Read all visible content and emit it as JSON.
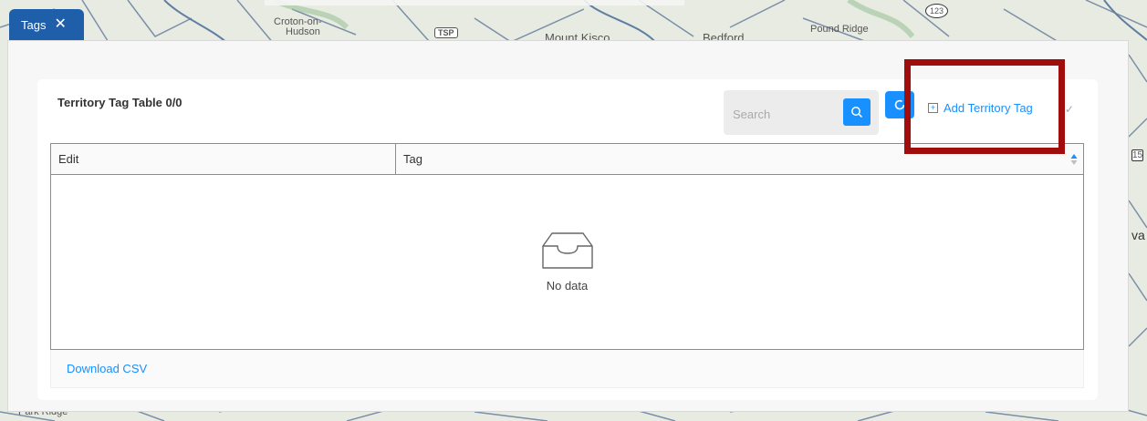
{
  "map": {
    "labels": {
      "croton": "Croton-on-",
      "hudson": "Hudson",
      "tsp": "TSP",
      "mount_kisco": "Mount Kisco",
      "bedford": "Bedford",
      "pound_ridge": "Pound Ridge",
      "route_123": "123",
      "park_ridge": "Park Ridge",
      "edge_15": "15",
      "edge_va": "va"
    }
  },
  "tab": {
    "label": "Tags",
    "close_glyph": "✕"
  },
  "card": {
    "title": "Territory Tag Table 0/0",
    "search_placeholder": "Search",
    "add_label": "Add Territory Tag",
    "add_icon_glyph": "+",
    "collapse_glyph": "✓"
  },
  "table": {
    "columns": [
      "Edit",
      "Tag"
    ],
    "empty_text": "No data"
  },
  "footer": {
    "download_label": "Download CSV"
  },
  "colors": {
    "primary": "#1890ff",
    "tab": "#1f5fa9",
    "highlight": "#a00d0d"
  },
  "icons": {
    "close": "close-icon",
    "search": "search-icon",
    "refresh": "refresh-icon",
    "add": "plus-square-icon",
    "sort": "sort-icon",
    "empty": "inbox-icon"
  }
}
